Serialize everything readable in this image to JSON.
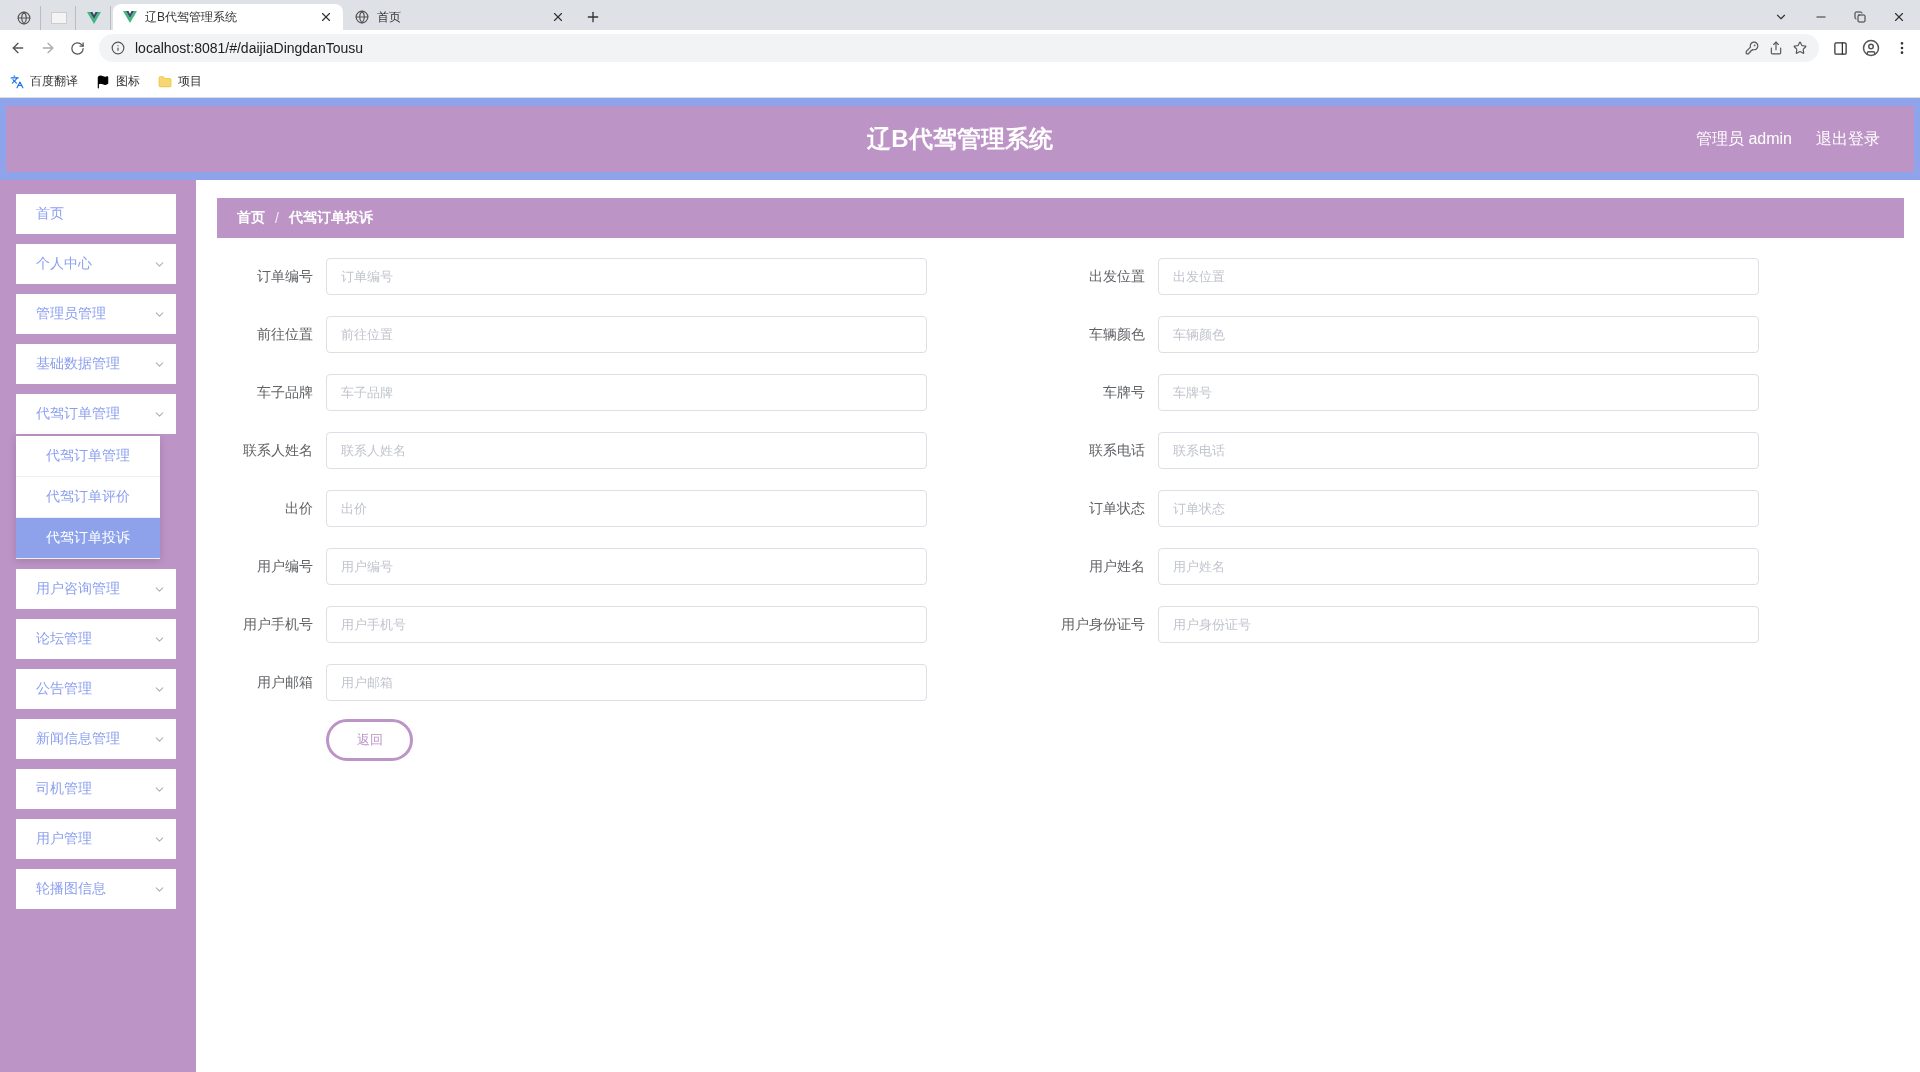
{
  "browser": {
    "tabs": [
      {
        "title": "辽B代驾管理系统",
        "selected": true
      },
      {
        "title": "首页",
        "selected": false
      }
    ],
    "url": "localhost:8081/#/daijiaDingdanTousu",
    "bookmarks": [
      {
        "label": "百度翻译",
        "kind": "translate"
      },
      {
        "label": "图标",
        "kind": "flag"
      },
      {
        "label": "项目",
        "kind": "folder"
      }
    ]
  },
  "header": {
    "title": "辽B代驾管理系统",
    "user": "管理员 admin",
    "logout": "退出登录"
  },
  "sidebar": {
    "items": [
      {
        "label": "首页",
        "kind": "link"
      },
      {
        "label": "个人中心",
        "kind": "submenu"
      },
      {
        "label": "管理员管理",
        "kind": "submenu"
      },
      {
        "label": "基础数据管理",
        "kind": "submenu"
      },
      {
        "label": "代驾订单管理",
        "kind": "submenu",
        "children": [
          {
            "label": "代驾订单管理",
            "selected": false
          },
          {
            "label": "代驾订单评价",
            "selected": false
          },
          {
            "label": "代驾订单投诉",
            "selected": true
          }
        ]
      },
      {
        "label": "用户咨询管理",
        "kind": "submenu"
      },
      {
        "label": "论坛管理",
        "kind": "submenu"
      },
      {
        "label": "公告管理",
        "kind": "submenu"
      },
      {
        "label": "新闻信息管理",
        "kind": "submenu"
      },
      {
        "label": "司机管理",
        "kind": "submenu"
      },
      {
        "label": "用户管理",
        "kind": "submenu"
      },
      {
        "label": "轮播图信息",
        "kind": "submenu"
      }
    ]
  },
  "breadcrumb": [
    "首页",
    "代驾订单投诉"
  ],
  "breadcrumb_separator": "/",
  "form": {
    "fields": [
      {
        "label": "订单编号",
        "placeholder": "订单编号"
      },
      {
        "label": "出发位置",
        "placeholder": "出发位置"
      },
      {
        "label": "前往位置",
        "placeholder": "前往位置"
      },
      {
        "label": "车辆颜色",
        "placeholder": "车辆颜色"
      },
      {
        "label": "车子品牌",
        "placeholder": "车子品牌"
      },
      {
        "label": "车牌号",
        "placeholder": "车牌号"
      },
      {
        "label": "联系人姓名",
        "placeholder": "联系人姓名"
      },
      {
        "label": "联系电话",
        "placeholder": "联系电话"
      },
      {
        "label": "出价",
        "placeholder": "出价"
      },
      {
        "label": "订单状态",
        "placeholder": "订单状态"
      },
      {
        "label": "用户编号",
        "placeholder": "用户编号"
      },
      {
        "label": "用户姓名",
        "placeholder": "用户姓名"
      },
      {
        "label": "用户手机号",
        "placeholder": "用户手机号"
      },
      {
        "label": "用户身份证号",
        "placeholder": "用户身份证号"
      },
      {
        "label": "用户邮箱",
        "placeholder": "用户邮箱"
      }
    ],
    "back_button": "返回"
  }
}
